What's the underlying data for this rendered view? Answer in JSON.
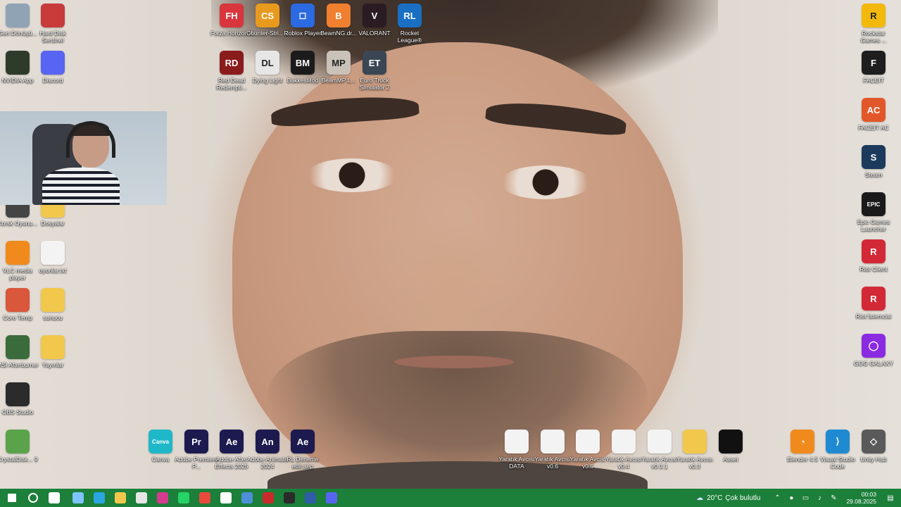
{
  "desktop_left": [
    {
      "label": "Geri Dönüşü...",
      "icon": "recycle-bin-icon",
      "color": "#8fa3b5"
    },
    {
      "label": "Hard Disk Sentinel",
      "icon": "hard-disk-sentinel-icon",
      "color": "#c73b3b"
    },
    {
      "label": "NVIDIA App",
      "icon": "nvidia-icon",
      "color": "#2f3b2a"
    },
    {
      "label": "Discord",
      "icon": "discord-icon",
      "color": "#5865f2"
    },
    {
      "label": "Korsk Oyunu...",
      "icon": "game-icon",
      "color": "#444444"
    },
    {
      "label": "Dosyalar",
      "icon": "folder-icon",
      "color": "#f1c84b"
    },
    {
      "label": "VLC media player",
      "icon": "vlc-icon",
      "color": "#f08a1c"
    },
    {
      "label": "oyunlar.txt",
      "icon": "text-file-icon",
      "color": "#f3f3f3"
    },
    {
      "label": "Core Temp",
      "icon": "core-temp-icon",
      "color": "#d9573a"
    },
    {
      "label": "sunucu",
      "icon": "folder-icon",
      "color": "#f1c84b"
    },
    {
      "label": "MSI Afterburner",
      "icon": "msi-afterburner-icon",
      "color": "#3a6b3a"
    },
    {
      "label": "Yayınlar",
      "icon": "folder-icon",
      "color": "#f1c84b"
    },
    {
      "label": "OBS Studio",
      "icon": "obs-icon",
      "color": "#2b2b2b"
    },
    {
      "label": "CrystalDisk... 9",
      "icon": "crystaldisk-icon",
      "color": "#5aa34a"
    }
  ],
  "desktop_top": [
    {
      "label": "Forza Horizon 4",
      "icon": "forza-icon",
      "color": "#d8363c",
      "text": "FH"
    },
    {
      "label": "Counter-Stri... 2",
      "icon": "counter-strike-icon",
      "color": "#e89a1e",
      "text": "CS"
    },
    {
      "label": "Roblox Player",
      "icon": "roblox-icon",
      "color": "#2b6ae0",
      "text": "◻"
    },
    {
      "label": "BeamNG.dr...",
      "icon": "beamng-icon",
      "color": "#f08030",
      "text": "B"
    },
    {
      "label": "VALORANT",
      "icon": "valorant-icon",
      "color": "#2a1c22",
      "text": "V"
    },
    {
      "label": "Rocket League®",
      "icon": "rocket-league-icon",
      "color": "#1a6fc2",
      "text": "RL"
    },
    {
      "label": "Red Dead Redempti...",
      "icon": "red-dead-icon",
      "color": "#8a1b1b",
      "text": "RD"
    },
    {
      "label": "Dying Light",
      "icon": "dying-light-icon",
      "color": "#e6e6e6",
      "text": "DL"
    },
    {
      "label": "BakkesMod",
      "icon": "bakkesmod-icon",
      "color": "#1b1b1b",
      "text": "BM"
    },
    {
      "label": "BeamMP L...",
      "icon": "beammp-icon",
      "color": "#c9c2b8",
      "text": "MP"
    },
    {
      "label": "Euro Truck Simulator 2",
      "icon": "euro-truck-icon",
      "color": "#3a4654",
      "text": "ET"
    }
  ],
  "desktop_right": [
    {
      "label": "Rockstar Games ...",
      "icon": "rockstar-icon",
      "color": "#f2b90c",
      "text": "R"
    },
    {
      "label": "FACEIT",
      "icon": "faceit-icon",
      "color": "#1e1e1e",
      "text": "F"
    },
    {
      "label": "FACEIT AC",
      "icon": "faceit-ac-icon",
      "color": "#e2572a",
      "text": "AC"
    },
    {
      "label": "Steam",
      "icon": "steam-icon",
      "color": "#1b3a5c",
      "text": "S"
    },
    {
      "label": "Epic Games Launcher",
      "icon": "epic-games-icon",
      "color": "#1a1a1a",
      "text": "EPIC"
    },
    {
      "label": "Riot Client",
      "icon": "riot-client-icon",
      "color": "#d32936",
      "text": "R"
    },
    {
      "label": "Riot İstemcisi",
      "icon": "riot-client-icon",
      "color": "#d32936",
      "text": "R"
    },
    {
      "label": "GOG GALAXY",
      "icon": "gog-galaxy-icon",
      "color": "#8a2be2",
      "text": "◯"
    }
  ],
  "desktop_bottom": [
    {
      "label": "Canva",
      "icon": "canva-icon",
      "color": "#1fb8c9",
      "text": "Canva"
    },
    {
      "label": "Adobe Premiere P...",
      "icon": "premiere-icon",
      "color": "#1c1a4f",
      "text": "Pr"
    },
    {
      "label": "Adobe After Effects 2025",
      "icon": "after-effects-icon",
      "color": "#1c1a4f",
      "text": "Ae"
    },
    {
      "label": "Adobe Animate 2024",
      "icon": "animate-icon",
      "color": "#1c1a4f",
      "text": "An"
    },
    {
      "label": "RL Deneme edit.aep",
      "icon": "aep-file-icon",
      "color": "#1c1a4f",
      "text": "Ae"
    },
    {
      "label": "Yaratık Avcısı DATA",
      "icon": "file-icon",
      "color": "#f3f3f3",
      "text": ""
    },
    {
      "label": "Yaratık Avcısı v0.6",
      "icon": "file-icon",
      "color": "#f3f3f3",
      "text": ""
    },
    {
      "label": "Yaratık Avcısı v0.5",
      "icon": "file-icon",
      "color": "#f3f3f3",
      "text": ""
    },
    {
      "label": "Yaratık Avcısı v0.4",
      "icon": "file-icon",
      "color": "#f3f3f3",
      "text": ""
    },
    {
      "label": "Yaratık Avcısı v0.3.1",
      "icon": "file-icon",
      "color": "#f3f3f3",
      "text": ""
    },
    {
      "label": "Yaratık Avcısı v0.3",
      "icon": "folder-icon",
      "color": "#f1c84b",
      "text": ""
    },
    {
      "label": "Asset",
      "icon": "file-icon",
      "color": "#111111",
      "text": ""
    },
    {
      "label": "Blender 4.5",
      "icon": "blender-icon",
      "color": "#f08a1c",
      "text": "◔"
    },
    {
      "label": "Visual Studio Code",
      "icon": "vscode-icon",
      "color": "#1f8ad2",
      "text": "⟩"
    },
    {
      "label": "Unity Hub",
      "icon": "unity-hub-icon",
      "color": "#5a5a5a",
      "text": "◇"
    }
  ],
  "taskbar": {
    "apps": [
      {
        "name": "start-icon",
        "color": "#ffffff"
      },
      {
        "name": "search-icon",
        "color": "#ffffff"
      },
      {
        "name": "task-view-icon",
        "color": "#ffffff"
      },
      {
        "name": "copilot-icon",
        "color": "#7dc4ff"
      },
      {
        "name": "edge-icon",
        "color": "#2aa6e3"
      },
      {
        "name": "file-explorer-icon",
        "color": "#f1c84b"
      },
      {
        "name": "store-icon",
        "color": "#e6e6e6"
      },
      {
        "name": "instagram-icon",
        "color": "#d63b8f"
      },
      {
        "name": "whatsapp-icon",
        "color": "#25d366"
      },
      {
        "name": "chrome-icon",
        "color": "#e84a3c"
      },
      {
        "name": "chatgpt-icon",
        "color": "#ffffff"
      },
      {
        "name": "app-icon",
        "color": "#4d90d8"
      },
      {
        "name": "voice-meeter-icon",
        "color": "#c92b2b"
      },
      {
        "name": "record-icon",
        "color": "#2b2b2b"
      },
      {
        "name": "shield-icon",
        "color": "#2f5ea6"
      },
      {
        "name": "discord-app-icon",
        "color": "#5865f2"
      }
    ],
    "weather": {
      "temp": "20°C",
      "desc": "Çok bulutlu"
    },
    "time": "00:03",
    "date": "29.08.2025"
  }
}
